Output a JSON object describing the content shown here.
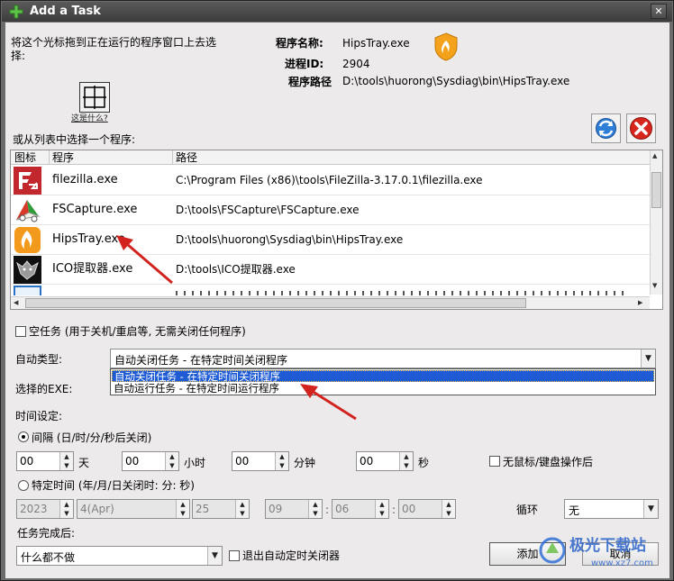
{
  "window": {
    "title": "Add a Task",
    "close_glyph": "✕"
  },
  "drag_hint": {
    "line1": "将这个光标拖到正在运行的程序窗口上去选",
    "line2": "择:",
    "whatis": "这是什么?"
  },
  "program_info": {
    "name_label": "程序名称:",
    "name_value": "HipsTray.exe",
    "pid_label": "进程ID:",
    "pid_value": "2904",
    "path_label": "程序路径",
    "path_value": "D:\\tools\\huorong\\Sysdiag\\bin\\HipsTray.exe"
  },
  "list_prompt": "或从列表中选择一个程序:",
  "table": {
    "columns": [
      "图标",
      "程序",
      "路径"
    ],
    "rows": [
      {
        "icon": "filezilla-icon",
        "program": "filezilla.exe",
        "path": "C:\\Program Files (x86)\\tools\\FileZilla-3.17.0.1\\filezilla.exe"
      },
      {
        "icon": "fscapture-icon",
        "program": "FSCapture.exe",
        "path": "D:\\tools\\FSCapture\\FSCapture.exe"
      },
      {
        "icon": "hipstray-icon",
        "program": "HipsTray.exe",
        "path": "D:\\tools\\huorong\\Sysdiag\\bin\\HipsTray.exe"
      },
      {
        "icon": "ico-extractor-icon",
        "program": "ICO提取器.exe",
        "path": "D:\\tools\\ICO提取器.exe"
      }
    ]
  },
  "empty_task_label": "空任务 (用于关机/重启等, 无需关闭任何程序)",
  "auto_type": {
    "label": "自动类型:",
    "selected": "自动关闭任务 - 在特定时间关闭程序",
    "options": [
      "自动关闭任务 - 在特定时间关闭程序",
      "自动运行任务 - 在特定时间运行程序"
    ]
  },
  "selected_exe_label": "选择的EXE:",
  "time_setting_label": "时间设定:",
  "interval": {
    "label": "间隔 (日/时/分/秒后关闭)",
    "days": "00",
    "days_unit": "天",
    "hours": "00",
    "hours_unit": "小时",
    "minutes": "00",
    "minutes_unit": "分钟",
    "seconds": "00",
    "seconds_unit": "秒"
  },
  "no_input_label": "无鼠标/键盘操作后",
  "specific_time": {
    "label": "特定时间 (年/月/日关闭时: 分: 秒)",
    "year": "2023",
    "month": "4(Apr)",
    "day": "25",
    "hour": "09",
    "minute": "06",
    "second": "00",
    "colon": ":"
  },
  "loop": {
    "label": "循环",
    "value": "无"
  },
  "after_complete": {
    "label": "任务完成后:",
    "value": "什么都不做"
  },
  "exit_auto_label": "退出自动定时关闭器",
  "buttons": {
    "add": "添加",
    "cancel": "取消"
  },
  "watermark": {
    "text": "极光下载站",
    "url": "www.xz7.com"
  },
  "colors": {
    "selection": "#1e5bd5",
    "arrow": "#d2231f",
    "title_bg": "#4a4a4a"
  }
}
